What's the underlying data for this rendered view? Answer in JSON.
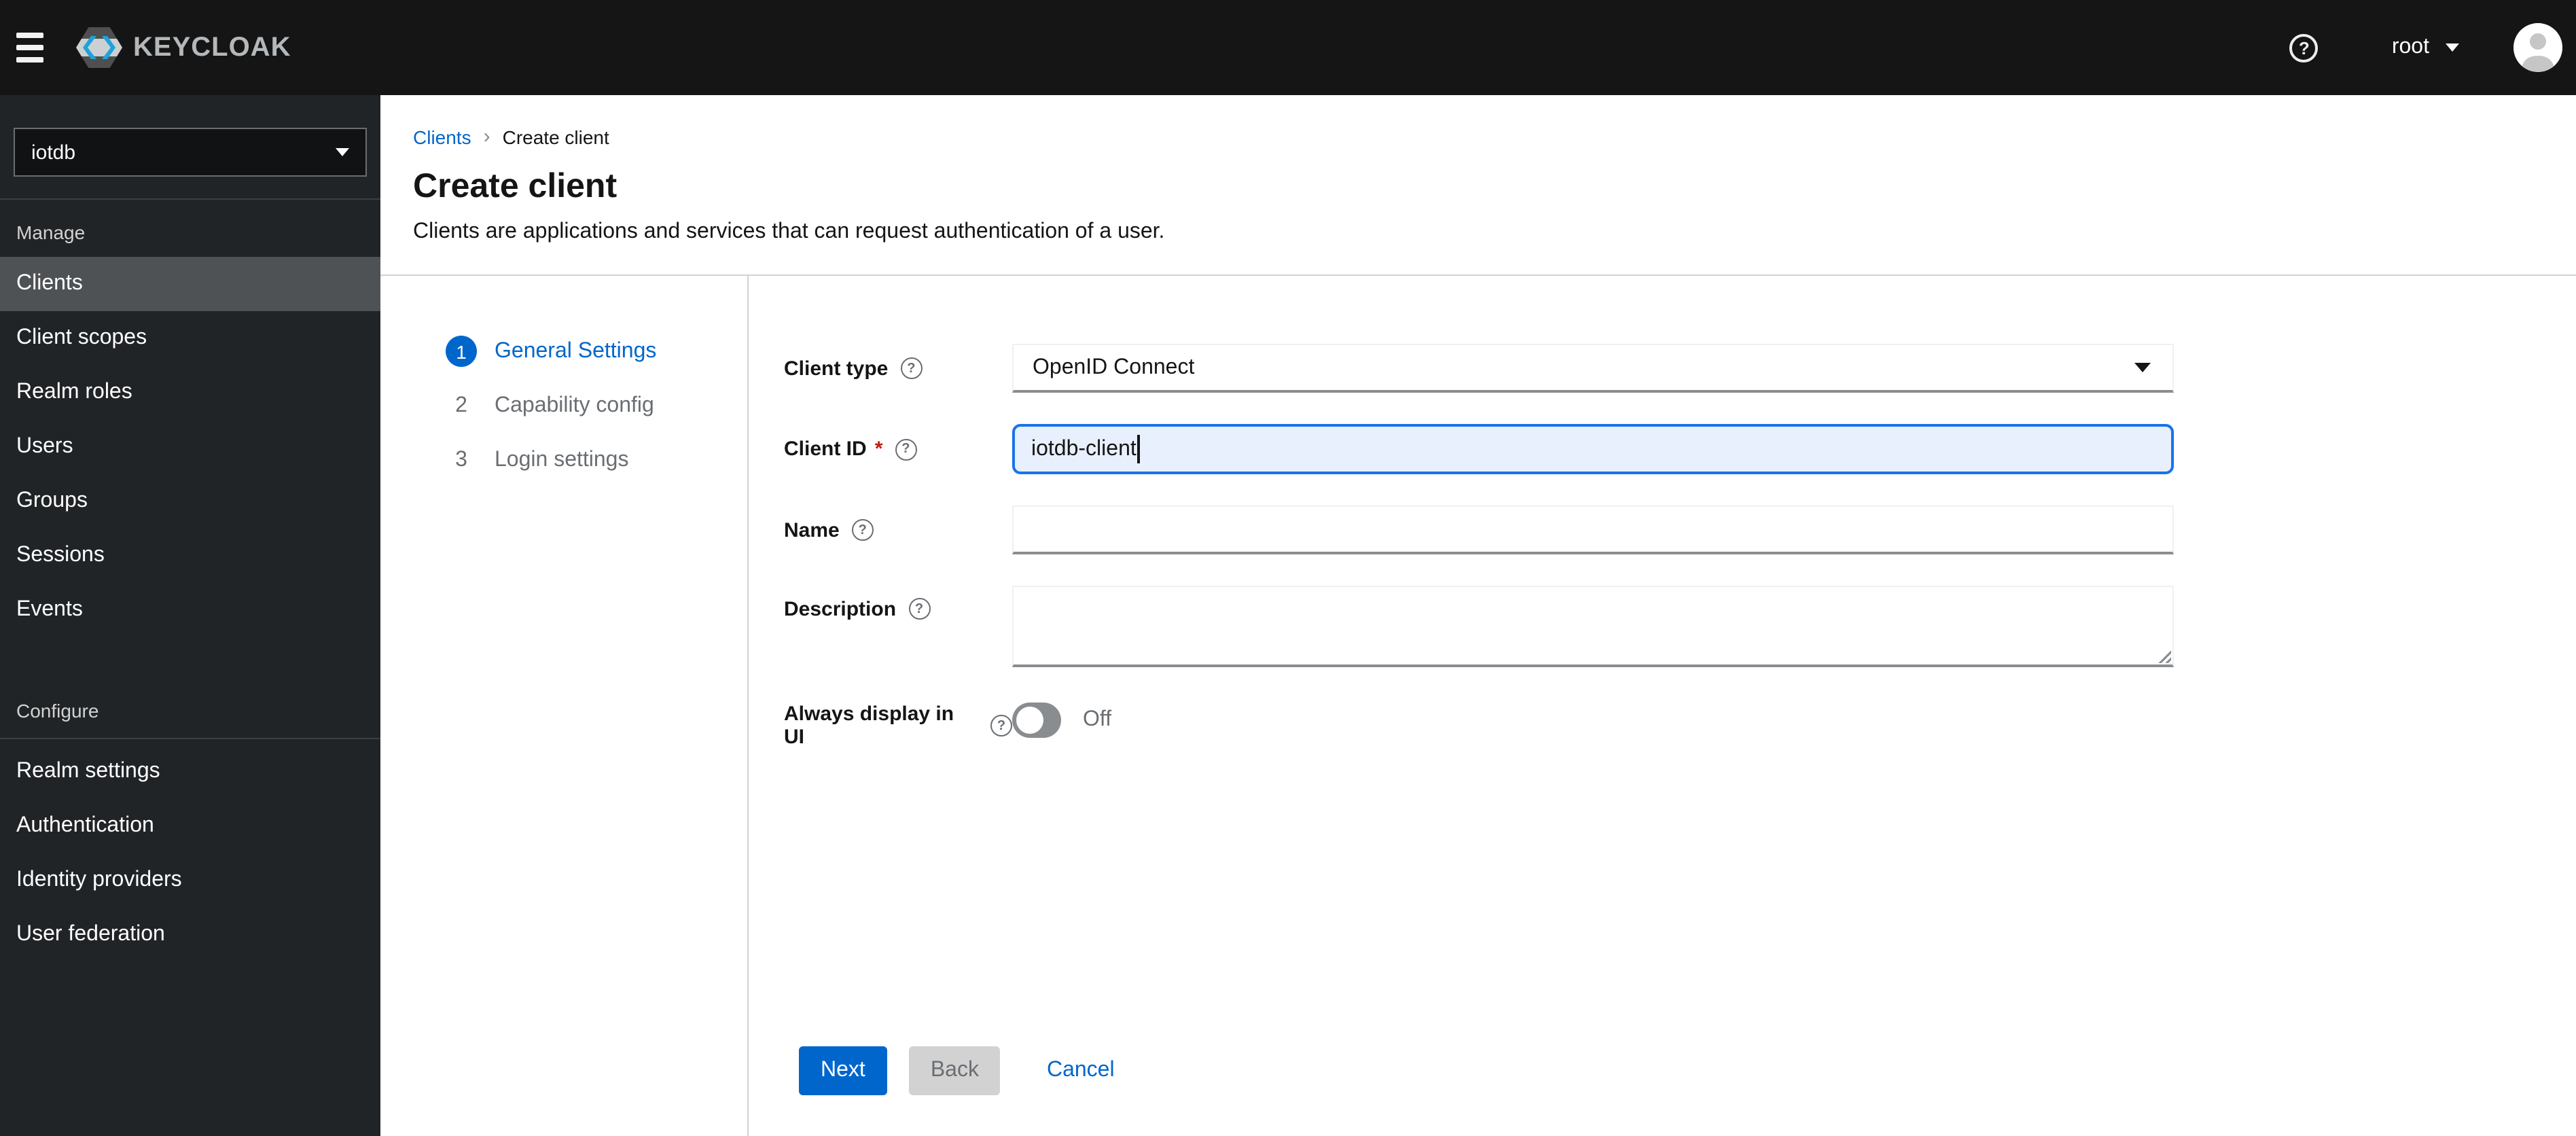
{
  "masthead": {
    "brand": "KEYCLOAK",
    "username": "root"
  },
  "sidebar": {
    "realm": "iotdb",
    "sections": [
      {
        "title": "Manage",
        "items": [
          {
            "label": "Clients",
            "selected": true
          },
          {
            "label": "Client scopes"
          },
          {
            "label": "Realm roles"
          },
          {
            "label": "Users"
          },
          {
            "label": "Groups"
          },
          {
            "label": "Sessions"
          },
          {
            "label": "Events"
          }
        ]
      },
      {
        "title": "Configure",
        "items": [
          {
            "label": "Realm settings"
          },
          {
            "label": "Authentication"
          },
          {
            "label": "Identity providers"
          },
          {
            "label": "User federation"
          }
        ]
      }
    ]
  },
  "breadcrumb": {
    "parent": "Clients",
    "current": "Create client"
  },
  "page": {
    "title": "Create client",
    "subtitle": "Clients are applications and services that can request authentication of a user."
  },
  "wizard": {
    "steps": [
      {
        "num": "1",
        "label": "General Settings",
        "active": true
      },
      {
        "num": "2",
        "label": "Capability config",
        "active": false
      },
      {
        "num": "3",
        "label": "Login settings",
        "active": false
      }
    ]
  },
  "form": {
    "client_type": {
      "label": "Client type",
      "value": "OpenID Connect"
    },
    "client_id": {
      "label": "Client ID",
      "required_marker": "*",
      "value": "iotdb-client"
    },
    "name": {
      "label": "Name",
      "value": ""
    },
    "description": {
      "label": "Description",
      "value": ""
    },
    "always_display": {
      "label": "Always display in UI",
      "state": "Off"
    }
  },
  "actions": {
    "next": "Next",
    "back": "Back",
    "cancel": "Cancel"
  },
  "icons": {
    "hamburger": "menu-icon",
    "help": "question-circle-icon",
    "user_caret": "chevron-down-icon",
    "avatar": "user-avatar-icon",
    "realm_caret": "chevron-down-icon",
    "select_caret": "caret-down-icon"
  },
  "colors": {
    "accent": "#0066cc",
    "link": "#0066cc",
    "masthead_bg": "#151515",
    "sidebar_bg": "#212427",
    "sidebar_selected_bg": "#4f5255",
    "focus_border": "#1a73e8",
    "focus_bg": "#e8f0fe",
    "required_red": "#c9190b",
    "divider": "#d2d2d2",
    "logo_blue": "#1ea3d8"
  }
}
